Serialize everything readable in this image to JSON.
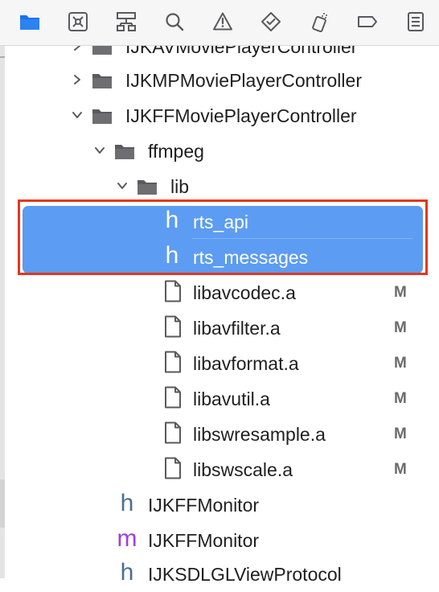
{
  "toolbar": {
    "icons": [
      {
        "name": "project-navigator-icon",
        "color": "#1a73e8",
        "selected": true
      },
      {
        "name": "source-control-icon"
      },
      {
        "name": "symbol-navigator-icon"
      },
      {
        "name": "find-navigator-icon"
      },
      {
        "name": "issue-navigator-icon"
      },
      {
        "name": "test-navigator-icon"
      },
      {
        "name": "debug-navigator-icon"
      },
      {
        "name": "breakpoint-navigator-icon"
      },
      {
        "name": "report-navigator-icon"
      }
    ]
  },
  "tree": [
    {
      "label": "IJKAVMoviePlayerController",
      "type": "folder",
      "expanded": false
    },
    {
      "label": "IJKMPMoviePlayerController",
      "type": "folder",
      "expanded": false
    },
    {
      "label": "IJKFFMoviePlayerController",
      "type": "folder",
      "expanded": true
    },
    {
      "label": "ffmpeg",
      "type": "folder",
      "expanded": true
    },
    {
      "label": "lib",
      "type": "folder",
      "expanded": true
    },
    {
      "label": "rts_api",
      "type": "header",
      "selected": true
    },
    {
      "label": "rts_messages",
      "type": "header",
      "selected": true
    },
    {
      "label": "libavcodec.a",
      "type": "file",
      "badge": "M"
    },
    {
      "label": "libavfilter.a",
      "type": "file",
      "badge": "M"
    },
    {
      "label": "libavformat.a",
      "type": "file",
      "badge": "M"
    },
    {
      "label": "libavutil.a",
      "type": "file",
      "badge": "M"
    },
    {
      "label": "libswresample.a",
      "type": "file",
      "badge": "M"
    },
    {
      "label": "libswscale.a",
      "type": "file",
      "badge": "M"
    },
    {
      "label": "IJKFFMonitor",
      "type": "header"
    },
    {
      "label": "IJKFFMonitor",
      "type": "implementation"
    },
    {
      "label": "IJKSDLGLViewProtocol",
      "type": "header"
    }
  ],
  "glyphs": {
    "header": "h",
    "implementation": "m"
  },
  "colors": {
    "selection": "#5c9cf2",
    "annotation": "#e3371f",
    "folder": "#5a5a5e"
  }
}
